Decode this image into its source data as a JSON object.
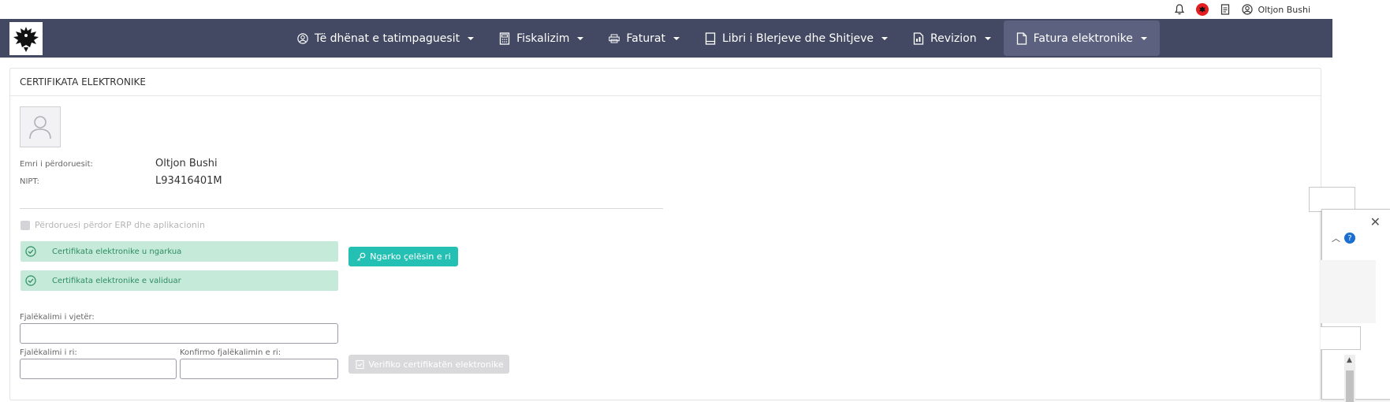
{
  "topbar": {
    "icons": [
      "bell-icon",
      "flag-albania-icon",
      "document-icon",
      "user-circle-icon"
    ],
    "user_name": "Oltjon Bushi"
  },
  "nav": {
    "items": [
      {
        "label": "Të dhënat e tatimpaguesit",
        "icon": "user-circle-icon"
      },
      {
        "label": "Fiskalizim",
        "icon": "calculator-icon"
      },
      {
        "label": "Faturat",
        "icon": "printer-icon"
      },
      {
        "label": "Libri i Blerjeve dhe Shitjeve",
        "icon": "book-icon"
      },
      {
        "label": "Revizion",
        "icon": "file-chart-icon"
      },
      {
        "label": "Fatura elektronike",
        "icon": "document-icon",
        "active": true
      }
    ],
    "colors": {
      "background": "#444963",
      "active": "#5c6180"
    }
  },
  "panel": {
    "title": "CERTIFIKATA ELEKTRONIKE",
    "user_label": "Emri i përdoruesit:",
    "user_value": "Oltjon Bushi",
    "nipt_label": "NIPT:",
    "nipt_value": "L93416401M",
    "erp_checkbox_label": "Përdoruesi përdor ERP dhe aplikacionin",
    "alerts": [
      "Certifikata elektronike u ngarkua",
      "Certifikata elektronike e validuar"
    ],
    "upload_key_button": "Ngarko çelësin e ri",
    "old_password_label": "Fjalëkalimi i vjetër:",
    "new_password_label": "Fjalëkalimi i ri:",
    "confirm_password_label": "Konfirmo fjalëkalimin e ri:",
    "verify_button": "Verifiko certifikatën elektronike",
    "colors": {
      "alert_bg": "#c5ead9",
      "alert_text": "#2e8c61",
      "teal_button": "#25c0b4",
      "disabled_button": "#d9d9dc"
    }
  },
  "side_widget": {
    "close_icon": "close-icon",
    "collapse_icon": "chevron-up-icon",
    "help_icon": "help-icon"
  }
}
